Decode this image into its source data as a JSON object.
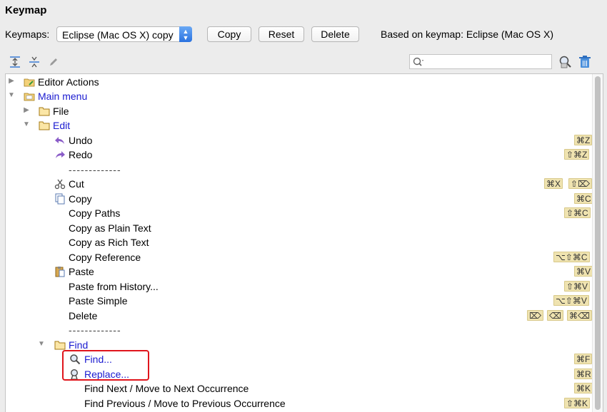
{
  "title": "Keymap",
  "keymaps_label": "Keymaps:",
  "keymap_selected": "Eclipse (Mac OS X) copy",
  "buttons": {
    "copy": "Copy",
    "reset": "Reset",
    "delete": "Delete"
  },
  "based_on": "Based on keymap: Eclipse (Mac OS X)",
  "search": {
    "placeholder": ""
  },
  "colors": {
    "link": "#1a1ad0",
    "highlight_border": "#e0151c",
    "shortcut_bg": "#efe3b0"
  },
  "tree": {
    "editor_actions": "Editor Actions",
    "main_menu": "Main menu",
    "file": "File",
    "edit": "Edit",
    "undo": {
      "label": "Undo",
      "shortcut": "⌘Z"
    },
    "redo": {
      "label": "Redo",
      "shortcut": "⇧⌘Z"
    },
    "separator": "-------------",
    "cut": {
      "label": "Cut",
      "shortcuts": [
        "⌘X",
        "⇧⌦"
      ]
    },
    "copy": {
      "label": "Copy",
      "shortcut": "⌘C"
    },
    "copy_paths": {
      "label": "Copy Paths",
      "shortcut": "⇧⌘C"
    },
    "copy_plain": {
      "label": "Copy as Plain Text"
    },
    "copy_rich": {
      "label": "Copy as Rich Text"
    },
    "copy_ref": {
      "label": "Copy Reference",
      "shortcut": "⌥⇧⌘C"
    },
    "paste": {
      "label": "Paste",
      "shortcut": "⌘V"
    },
    "paste_history": {
      "label": "Paste from History...",
      "shortcut": "⇧⌘V"
    },
    "paste_simple": {
      "label": "Paste Simple",
      "shortcut": "⌥⇧⌘V"
    },
    "delete": {
      "label": "Delete",
      "shortcuts": [
        "⌦",
        "⌫",
        "⌘⌫"
      ]
    },
    "find": "Find",
    "find_item": {
      "label": "Find...",
      "shortcut": "⌘F"
    },
    "replace_item": {
      "label": "Replace...",
      "shortcut": "⌘R"
    },
    "find_next": {
      "label": "Find Next / Move to Next Occurrence",
      "shortcut": "⌘K"
    },
    "find_prev": {
      "label": "Find Previous / Move to Previous Occurrence",
      "shortcut": "⇧⌘K"
    }
  }
}
